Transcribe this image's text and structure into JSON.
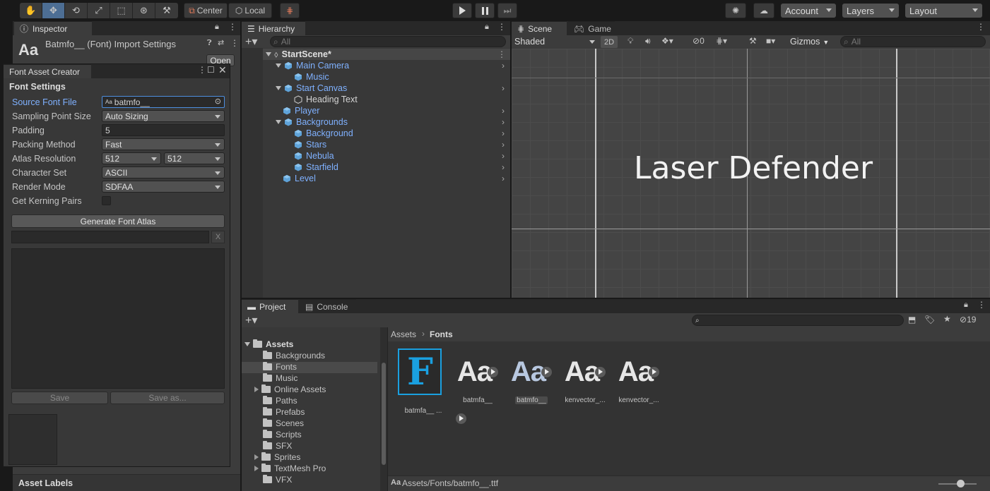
{
  "toolbar": {
    "pivot": "Center",
    "space": "Local",
    "account": "Account",
    "layers": "Layers",
    "layout": "Layout"
  },
  "inspector": {
    "tab": "Inspector",
    "title": "Batmfo__ (Font) Import Settings",
    "aa": "Aa",
    "open": "Open",
    "asset_labels": "Asset Labels"
  },
  "fac": {
    "title": "Font Asset Creator",
    "section": "Font Settings",
    "source_label": "Source Font File",
    "source_value": "batmfo__",
    "sampling_label": "Sampling Point Size",
    "sampling_value": "Auto Sizing",
    "padding_label": "Padding",
    "padding_value": "5",
    "packing_label": "Packing Method",
    "packing_value": "Fast",
    "atlas_label": "Atlas Resolution",
    "atlas_w": "512",
    "atlas_h": "512",
    "charset_label": "Character Set",
    "charset_value": "ASCII",
    "render_label": "Render Mode",
    "render_value": "SDFAA",
    "kerning_label": "Get Kerning Pairs",
    "generate": "Generate Font Atlas",
    "x": "X",
    "save": "Save",
    "save_as": "Save as..."
  },
  "hierarchy": {
    "tab": "Hierarchy",
    "search_placeholder": "All",
    "scene": "StartScene*",
    "items": [
      "Main Camera",
      "Music",
      "Start Canvas",
      "Heading Text",
      "Player",
      "Backgrounds",
      "Background",
      "Stars",
      "Nebula",
      "Starfield",
      "Level"
    ]
  },
  "scene": {
    "tab_scene": "Scene",
    "tab_game": "Game",
    "shading": "Shaded",
    "mode2d": "2D",
    "hidden_count": "0",
    "gizmos": "Gizmos",
    "search_placeholder": "All",
    "heading": "Laser Defender"
  },
  "project": {
    "tab_project": "Project",
    "tab_console": "Console",
    "hidden_count": "19",
    "root": "Assets",
    "folders": [
      "Backgrounds",
      "Fonts",
      "Music",
      "Online Assets",
      "Paths",
      "Prefabs",
      "Scenes",
      "Scripts",
      "SFX",
      "Sprites",
      "TextMesh Pro",
      "VFX"
    ],
    "breadcrumb_root": "Assets",
    "breadcrumb_current": "Fonts",
    "assets": [
      {
        "big": "F",
        "cap": "batmfa__ ..."
      },
      {
        "big": "Aa",
        "cap": "batmfa__"
      },
      {
        "big": "Aa",
        "cap": "batmfo__"
      },
      {
        "big": "Aa",
        "cap": "kenvector_..."
      },
      {
        "big": "Aa",
        "cap": "kenvector_..."
      }
    ],
    "status_prefix": "Aa",
    "status_path": "Assets/Fonts/batmfo__.ttf"
  }
}
